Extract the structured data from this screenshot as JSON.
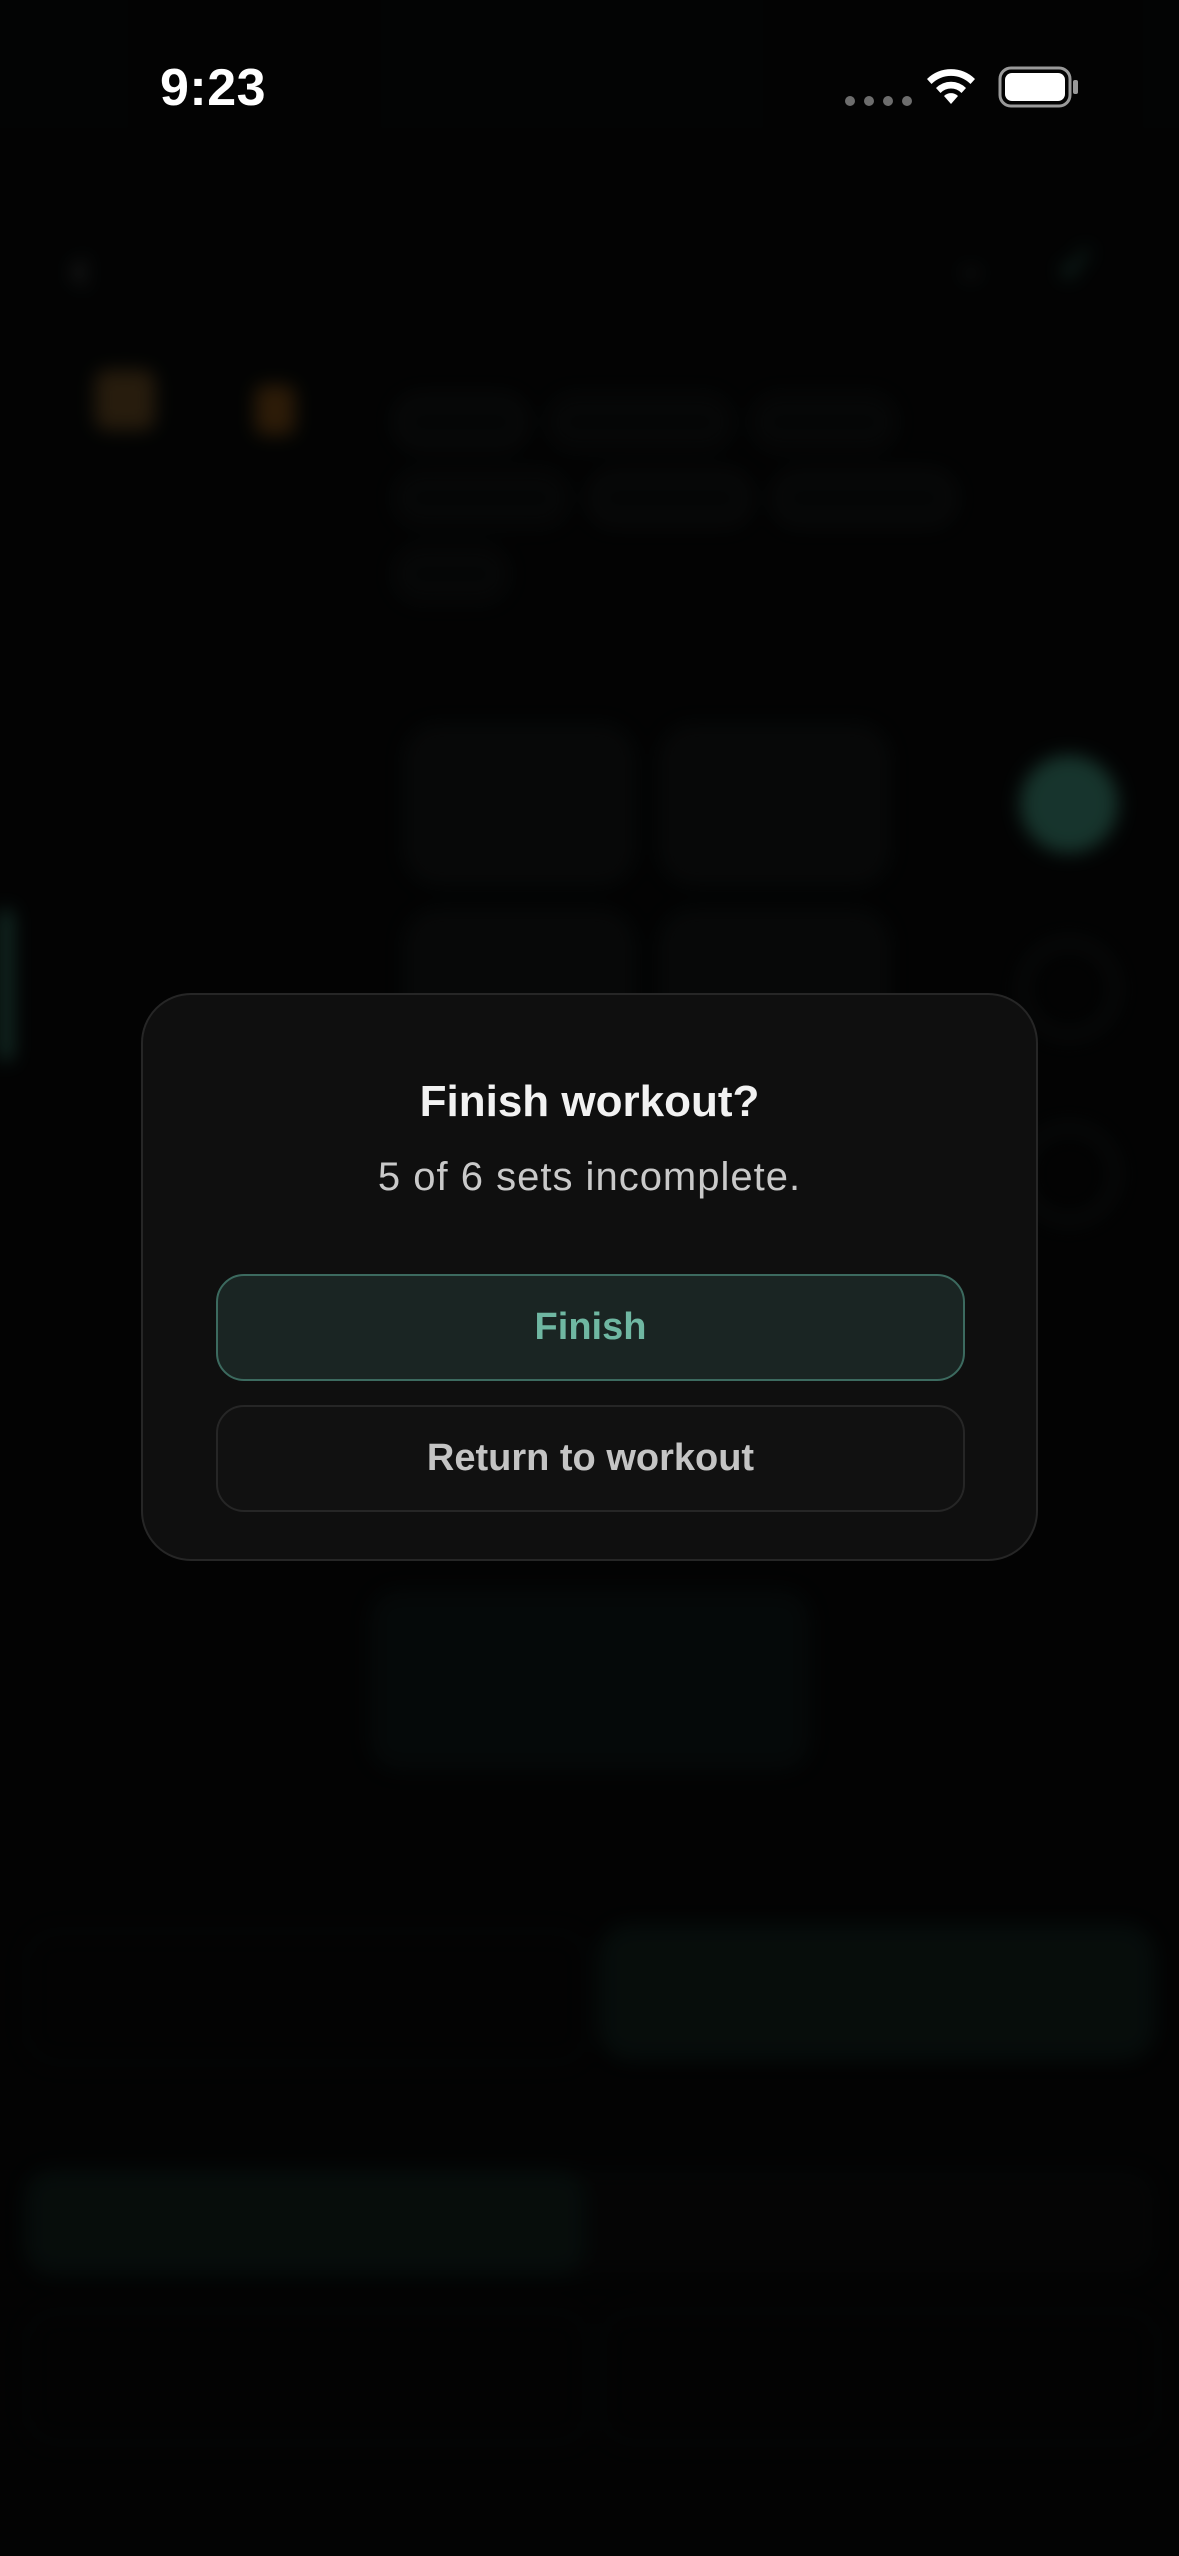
{
  "status_bar": {
    "time": "9:23",
    "icons": [
      "cellular-signal-icon",
      "wifi-icon",
      "battery-icon"
    ]
  },
  "dialog": {
    "title": "Finish workout?",
    "message": "5 of 6 sets incomplete.",
    "primary_button": "Finish",
    "secondary_button": "Return to workout"
  },
  "colors": {
    "accent": "#6fb7a2",
    "accent_border": "#3c6a5f",
    "dialog_background": "#0f0f0f",
    "page_background": "#050606"
  }
}
